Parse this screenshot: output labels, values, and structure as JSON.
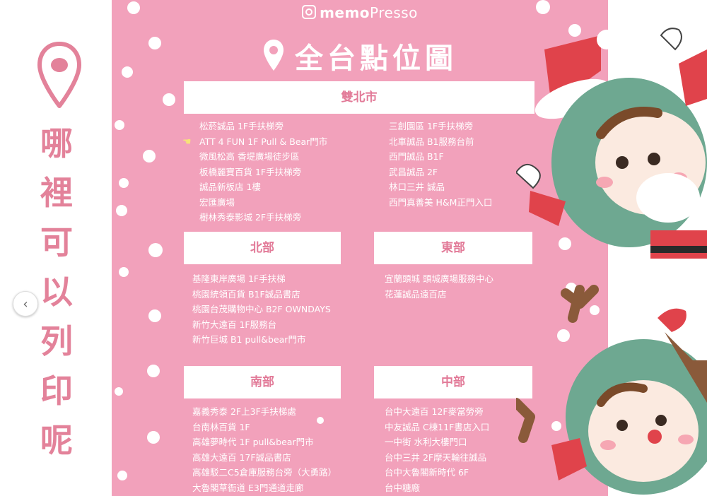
{
  "side_caption": [
    "哪",
    "裡",
    "可",
    "以",
    "列",
    "印",
    "呢"
  ],
  "carousel": {
    "prev_icon": "chevron-left-icon",
    "prev_glyph": "‹"
  },
  "brand": {
    "prefix": "memo",
    "suffix": "Presso"
  },
  "title": "全台點位圖",
  "colors": {
    "pink_bg": "#f2a1bb",
    "accent_text": "#e27a98",
    "caption": "#e3829a"
  },
  "regions": {
    "shuangbei": {
      "name": "雙北市",
      "left": [
        "松菸誠品 1F手扶梯旁",
        "ATT 4 FUN 1F Pull & Bear門市",
        "微風松高 香堤廣場徒步區",
        "板橋麗寶百貨 1F手扶梯旁",
        "誠品新板店 1樓",
        "宏匯廣場",
        "樹林秀泰影城 2F手扶梯旁"
      ],
      "right": [
        "三創園區 1F手扶梯旁",
        "北車誠品 B1服務台前",
        "西門誠品 B1F",
        "武昌誠品 2F",
        "林口三井 誠品",
        "西門真善美 H&M正門入口"
      ]
    },
    "north": {
      "name": "北部",
      "items": [
        "基隆東岸廣場 1F手扶梯",
        "桃園統領百貨 B1F誠品書店",
        "桃園台茂購物中心 B2F OWNDAYS",
        "新竹大遠百 1F服務台",
        "新竹巨城 B1 pull&bear門市"
      ]
    },
    "east": {
      "name": "東部",
      "items": [
        "宜蘭頭城 頭城廣場服務中心",
        "花蓮誠品遠百店"
      ]
    },
    "south": {
      "name": "南部",
      "items": [
        "嘉義秀泰 2F上3F手扶梯處",
        "台南林百貨 1F",
        "高雄夢時代 1F pull&bear門市",
        "高雄大遠百 17F誠品書店",
        "高雄駁二C5倉庫服務台旁（大勇路）",
        "大魯閣草衙道 E3門通道走廊"
      ]
    },
    "central": {
      "name": "中部",
      "items": [
        "台中大遠百 12F麥當勞旁",
        "中友誠品 C棟11F書店入口",
        "一中街 水利大樓門口",
        "台中三井 2F摩天輪往誠品",
        "台中大魯閣新時代 6F",
        "台中糖廠"
      ]
    }
  }
}
